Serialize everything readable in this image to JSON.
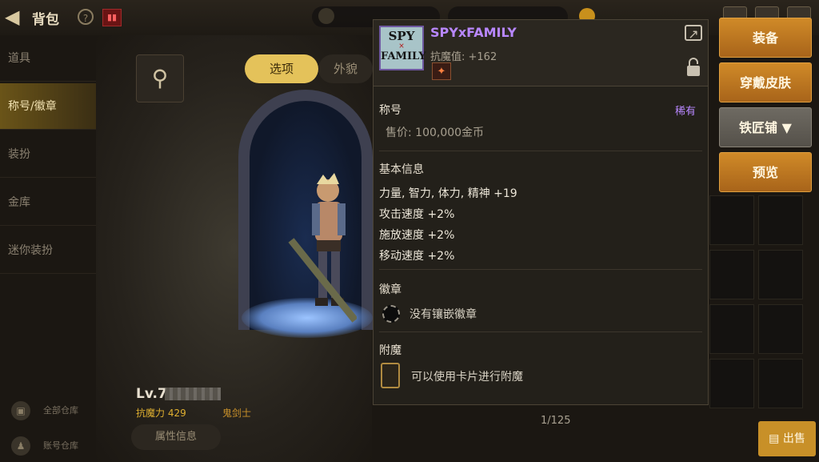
{
  "header": {
    "title": "背包"
  },
  "menu": {
    "items": [
      {
        "label": "道具"
      },
      {
        "label": "称号/徽章"
      },
      {
        "label": "装扮"
      },
      {
        "label": "金库"
      },
      {
        "label": "迷你装扮"
      }
    ]
  },
  "character": {
    "tabs": {
      "active": "选项",
      "inactive": "外貌"
    },
    "level": "Lv.7",
    "stat_line": "抗魔力 429",
    "class_name": "鬼剑士",
    "attr_button": "属性信息",
    "side_buttons": [
      "全部仓库",
      "账号仓库"
    ]
  },
  "item": {
    "name": "SPYxFAMILY",
    "icon_text": {
      "line1": "SPY",
      "line2": "×",
      "line3": "FAMILY"
    },
    "resist": "抗魔值: +162",
    "title_section": "称号",
    "rarity": "稀有",
    "price": "售价: 100,000金币",
    "basic_info_label": "基本信息",
    "stats": [
      "力量, 智力, 体力, 精神 +19",
      "攻击速度 +2%",
      "施放速度 +2%",
      "移动速度 +2%"
    ],
    "emblem_label": "徽章",
    "emblem_text": "没有镶嵌徽章",
    "enchant_label": "附魔",
    "enchant_text": "可以使用卡片进行附魔"
  },
  "actions": {
    "equip": "装备",
    "wear_skin": "穿戴皮肤",
    "blacksmith": "铁匠铺 ▼",
    "preview": "预览"
  },
  "inventory": {
    "page_count": "1/125",
    "sell_button": "出售"
  },
  "colors": {
    "rarity_purple": "#b887ff",
    "accent_gold": "#e4c25a",
    "button_orange": "#c07a22"
  }
}
